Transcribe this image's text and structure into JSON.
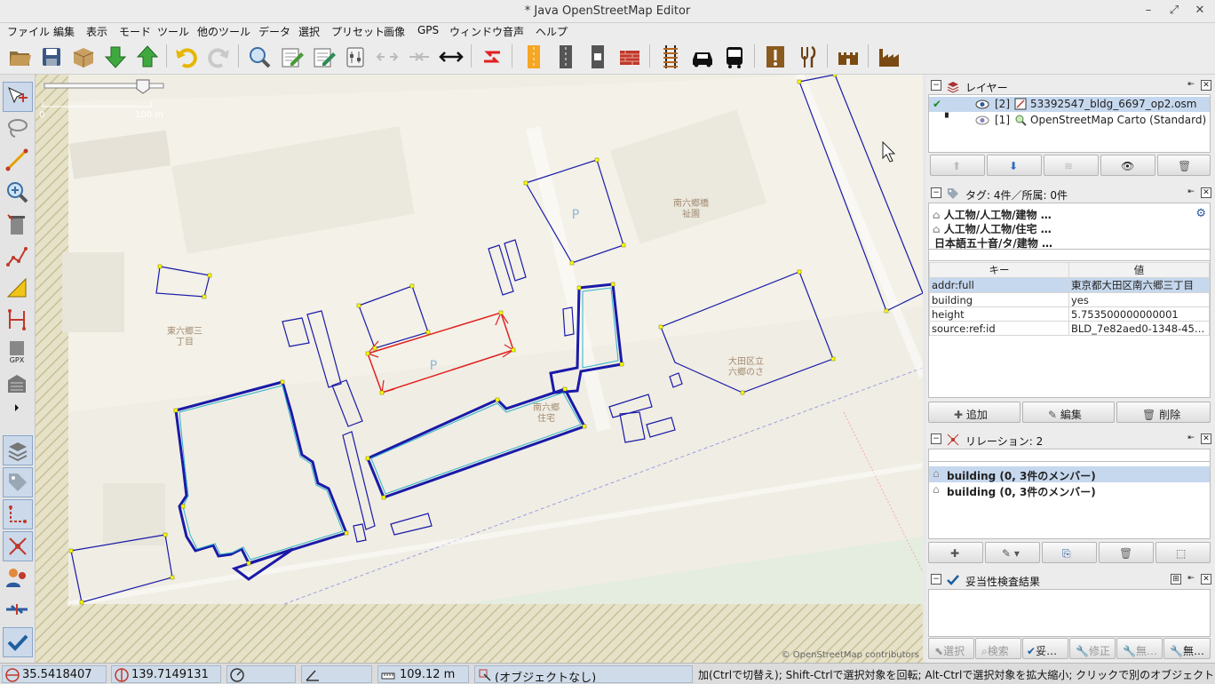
{
  "window": {
    "title": "* Java OpenStreetMap Editor",
    "controls": [
      "–",
      "⤢",
      "✕"
    ]
  },
  "menu": [
    "ファイル",
    "編集",
    "表示",
    "モード",
    "ツール",
    "他のツール",
    "データ",
    "選択",
    "プリセット",
    "画像",
    "GPS",
    "ウィンドウ",
    "音声",
    "ヘルプ"
  ],
  "toolbar": {
    "icons": [
      "open-icon",
      "save-icon",
      "upload-package-icon",
      "download-icon",
      "upload-icon",
      "undo-icon",
      "redo-icon",
      "zoom-icon",
      "edit-icon",
      "edit-alt-icon",
      "preferences-icon",
      "split-icon",
      "combine-icon",
      "align-icon",
      "reverse-icon",
      "road-icon",
      "road-dashed-icon",
      "traffic-light-icon",
      "wall-icon",
      "railway-icon",
      "car-icon",
      "bus-icon",
      "warning-icon",
      "restaurant-icon",
      "castle-icon",
      "factory-icon"
    ]
  },
  "left_tools": {
    "icons": [
      "select-icon",
      "lasso-icon",
      "draw-icon",
      "zoom-icon",
      "delete-icon",
      "improve-way-icon",
      "measure-icon",
      "parallel-icon",
      "gpx-icon",
      "building-icon",
      "expand-icon",
      "layers-icon",
      "tags-icon",
      "relation-icon",
      "relation-list-icon",
      "users-icon",
      "conflict-icon",
      "validator-icon"
    ]
  },
  "map": {
    "scale_start": "0",
    "scale_end": "100 m",
    "attribution": "© OpenStreetMap contributors",
    "labels": [
      {
        "text": "南六郷橋\n祉園"
      },
      {
        "text": "東六郷三\n丁目"
      },
      {
        "text": "南六郷\n住宅"
      },
      {
        "text": "大田区立\n六郷のさ"
      },
      {
        "text": "P"
      },
      {
        "text": "P"
      }
    ]
  },
  "layers_panel": {
    "title": "レイヤー",
    "layers": [
      {
        "index": "[2]",
        "name": "53392547_bldg_6697_op2.osm",
        "active": true
      },
      {
        "index": "[1]",
        "name": "OpenStreetMap Carto (Standard)",
        "active": false
      }
    ]
  },
  "tags_panel": {
    "title": "タグ: 4件／所属: 0件",
    "presets": [
      "人工物/人工物/建物 …",
      "人工物/人工物/住宅 …",
      "日本語五十音/タ/建物 …"
    ],
    "columns": [
      "キー",
      "値"
    ],
    "rows": [
      {
        "key": "addr:full",
        "value": "東京都大田区南六郷三丁目"
      },
      {
        "key": "building",
        "value": "yes"
      },
      {
        "key": "height",
        "value": "5.753500000000001"
      },
      {
        "key": "source:ref:id",
        "value": "BLD_7e82aed0-1348-45…"
      }
    ],
    "buttons": [
      "追加",
      "編集",
      "削除"
    ]
  },
  "relations_panel": {
    "title": "リレーション: 2",
    "items": [
      "building (0, 3件のメンバー)",
      "building (0, 3件のメンバー)"
    ]
  },
  "validation_panel": {
    "title": "妥当性検査結果",
    "buttons": [
      "選択",
      "検索",
      "妥…",
      "修正",
      "無…",
      "無…"
    ]
  },
  "statusbar": {
    "lat": "35.5418407",
    "lon": "139.7149131",
    "distance": "109.12 m",
    "object": "(オブジェクトなし)",
    "help": "加(Ctrlで切替え); Shift-Ctrlで選択対象を回転; Alt-Ctrlで選択対象を拡大縮小; クリックで別のオブジェクトを選択"
  },
  "colors": {
    "map_bg": "#f2efe9",
    "building_outline": "#1a1aa8",
    "selected": "#e02020",
    "node": "#ffff00",
    "status_field": "#cfdbe8"
  }
}
